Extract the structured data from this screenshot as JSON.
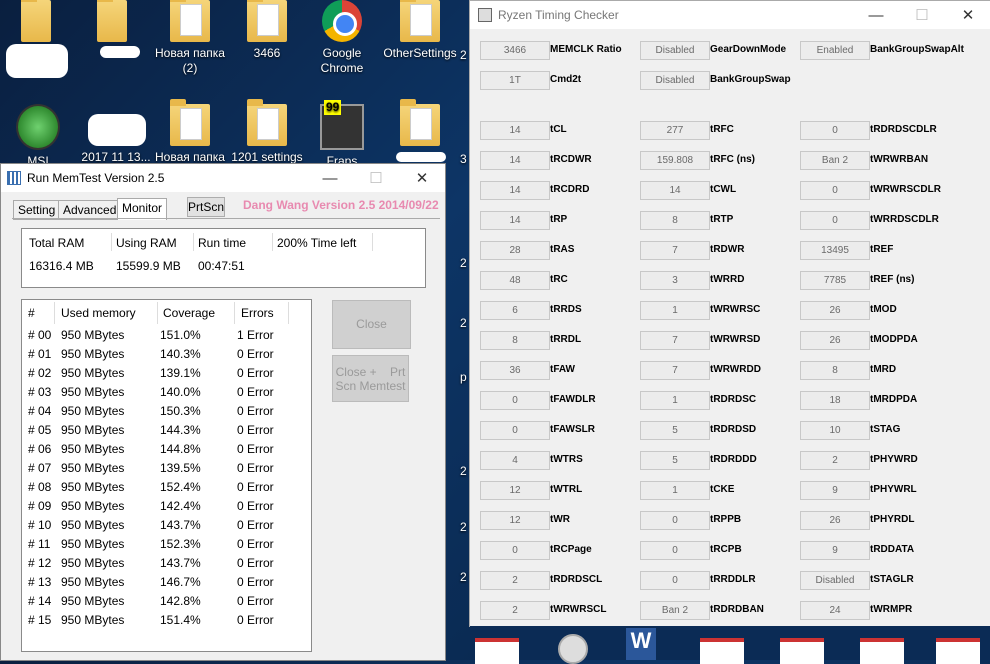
{
  "desktop": {
    "icons": [
      {
        "label": "Новая папка (2)",
        "line2": ""
      },
      {
        "label": "3466",
        "line2": ""
      },
      {
        "label": "Google Chrome",
        "line2": ""
      },
      {
        "label": "OtherSettings",
        "line2": ""
      },
      {
        "label": "MSI",
        "line2": ""
      },
      {
        "label": "2017 11 13...",
        "line2": ""
      },
      {
        "label": "Новая папка",
        "line2": ""
      },
      {
        "label": "1201 settings",
        "line2": ""
      },
      {
        "label": "Fraps",
        "line2": ""
      }
    ],
    "fraps_badge": "99",
    "edge_digits": [
      "2",
      "3",
      "2",
      "2",
      "2",
      "p",
      "2",
      "2",
      "2"
    ]
  },
  "memtest": {
    "title": "Run MemTest Version 2.5",
    "tabs": [
      "Setting",
      "Advanced",
      "Monitor"
    ],
    "prtscn": "PrtScn",
    "credit": "Dang Wang Version 2.5 2014/09/22",
    "summary_headers": [
      "Total RAM",
      "Using RAM",
      "Run time",
      "200% Time left"
    ],
    "summary_values": [
      "16316.4 MB",
      "15599.9 MB",
      "00:47:51",
      ""
    ],
    "table_headers": [
      "#",
      "Used memory",
      "Coverage",
      "Errors"
    ],
    "rows": [
      [
        "# 00",
        "950 MBytes",
        "151.0%",
        "1 Error"
      ],
      [
        "# 01",
        "950 MBytes",
        "140.3%",
        "0 Error"
      ],
      [
        "# 02",
        "950 MBytes",
        "139.1%",
        "0 Error"
      ],
      [
        "# 03",
        "950 MBytes",
        "140.0%",
        "0 Error"
      ],
      [
        "# 04",
        "950 MBytes",
        "150.3%",
        "0 Error"
      ],
      [
        "# 05",
        "950 MBytes",
        "144.3%",
        "0 Error"
      ],
      [
        "# 06",
        "950 MBytes",
        "144.8%",
        "0 Error"
      ],
      [
        "# 07",
        "950 MBytes",
        "139.5%",
        "0 Error"
      ],
      [
        "# 08",
        "950 MBytes",
        "152.4%",
        "0 Error"
      ],
      [
        "# 09",
        "950 MBytes",
        "142.4%",
        "0 Error"
      ],
      [
        "# 10",
        "950 MBytes",
        "143.7%",
        "0 Error"
      ],
      [
        "# 11",
        "950 MBytes",
        "152.3%",
        "0 Error"
      ],
      [
        "# 12",
        "950 MBytes",
        "143.7%",
        "0 Error"
      ],
      [
        "# 13",
        "950 MBytes",
        "146.7%",
        "0 Error"
      ],
      [
        "# 14",
        "950 MBytes",
        "142.8%",
        "0 Error"
      ],
      [
        "# 15",
        "950 MBytes",
        "151.4%",
        "0 Error"
      ]
    ],
    "close_btn": "Close Memtest",
    "close_prt_l1": "Close +    Prt",
    "close_prt_l2": "Scn Memtest"
  },
  "rtc": {
    "title": "Ryzen Timing Checker",
    "top_rows": [
      [
        {
          "v": "3466",
          "l": "MEMCLK Ratio"
        },
        {
          "v": "Disabled",
          "l": "GearDownMode"
        },
        {
          "v": "Enabled",
          "l": "BankGroupSwapAlt"
        }
      ],
      [
        {
          "v": "1T",
          "l": "Cmd2t"
        },
        {
          "v": "Disabled",
          "l": "BankGroupSwap"
        }
      ]
    ],
    "rows": [
      [
        {
          "v": "14",
          "l": "tCL"
        },
        {
          "v": "277",
          "l": "tRFC"
        },
        {
          "v": "0",
          "l": "tRDRDSCDLR"
        }
      ],
      [
        {
          "v": "14",
          "l": "tRCDWR"
        },
        {
          "v": "159.808",
          "l": "tRFC (ns)"
        },
        {
          "v": "Ban 2",
          "l": "tWRWRBAN"
        }
      ],
      [
        {
          "v": "14",
          "l": "tRCDRD"
        },
        {
          "v": "14",
          "l": "tCWL"
        },
        {
          "v": "0",
          "l": "tWRWRSCDLR"
        }
      ],
      [
        {
          "v": "14",
          "l": "tRP"
        },
        {
          "v": "8",
          "l": "tRTP"
        },
        {
          "v": "0",
          "l": "tWRRDSCDLR"
        }
      ],
      [
        {
          "v": "28",
          "l": "tRAS"
        },
        {
          "v": "7",
          "l": "tRDWR"
        },
        {
          "v": "13495",
          "l": "tREF"
        }
      ],
      [
        {
          "v": "48",
          "l": "tRC"
        },
        {
          "v": "3",
          "l": "tWRRD"
        },
        {
          "v": "7785",
          "l": "tREF (ns)"
        }
      ],
      [
        {
          "v": "6",
          "l": "tRRDS"
        },
        {
          "v": "1",
          "l": "tWRWRSC"
        },
        {
          "v": "26",
          "l": "tMOD"
        }
      ],
      [
        {
          "v": "8",
          "l": "tRRDL"
        },
        {
          "v": "7",
          "l": "tWRWRSD"
        },
        {
          "v": "26",
          "l": "tMODPDA"
        }
      ],
      [
        {
          "v": "36",
          "l": "tFAW"
        },
        {
          "v": "7",
          "l": "tWRWRDD"
        },
        {
          "v": "8",
          "l": "tMRD"
        }
      ],
      [
        {
          "v": "0",
          "l": "tFAWDLR"
        },
        {
          "v": "1",
          "l": "tRDRDSC"
        },
        {
          "v": "18",
          "l": "tMRDPDA"
        }
      ],
      [
        {
          "v": "0",
          "l": "tFAWSLR"
        },
        {
          "v": "5",
          "l": "tRDRDSD"
        },
        {
          "v": "10",
          "l": "tSTAG"
        }
      ],
      [
        {
          "v": "4",
          "l": "tWTRS"
        },
        {
          "v": "5",
          "l": "tRDRDDD"
        },
        {
          "v": "2",
          "l": "tPHYWRD"
        }
      ],
      [
        {
          "v": "12",
          "l": "tWTRL"
        },
        {
          "v": "1",
          "l": "tCKE"
        },
        {
          "v": "9",
          "l": "tPHYWRL"
        }
      ],
      [
        {
          "v": "12",
          "l": "tWR"
        },
        {
          "v": "0",
          "l": "tRPPB"
        },
        {
          "v": "26",
          "l": "tPHYRDL"
        }
      ],
      [
        {
          "v": "0",
          "l": "tRCPage"
        },
        {
          "v": "0",
          "l": "tRCPB"
        },
        {
          "v": "9",
          "l": "tRDDATA"
        }
      ],
      [
        {
          "v": "2",
          "l": "tRDRDSCL"
        },
        {
          "v": "0",
          "l": "tRRDDLR"
        },
        {
          "v": "Disabled",
          "l": "tSTAGLR"
        }
      ],
      [
        {
          "v": "2",
          "l": "tWRWRSCL"
        },
        {
          "v": "Ban 2",
          "l": "tRDRDBAN"
        },
        {
          "v": "24",
          "l": "tWRMPR"
        }
      ]
    ]
  },
  "controls": {
    "minimize": "—",
    "maximize": "☐",
    "close": "✕"
  }
}
